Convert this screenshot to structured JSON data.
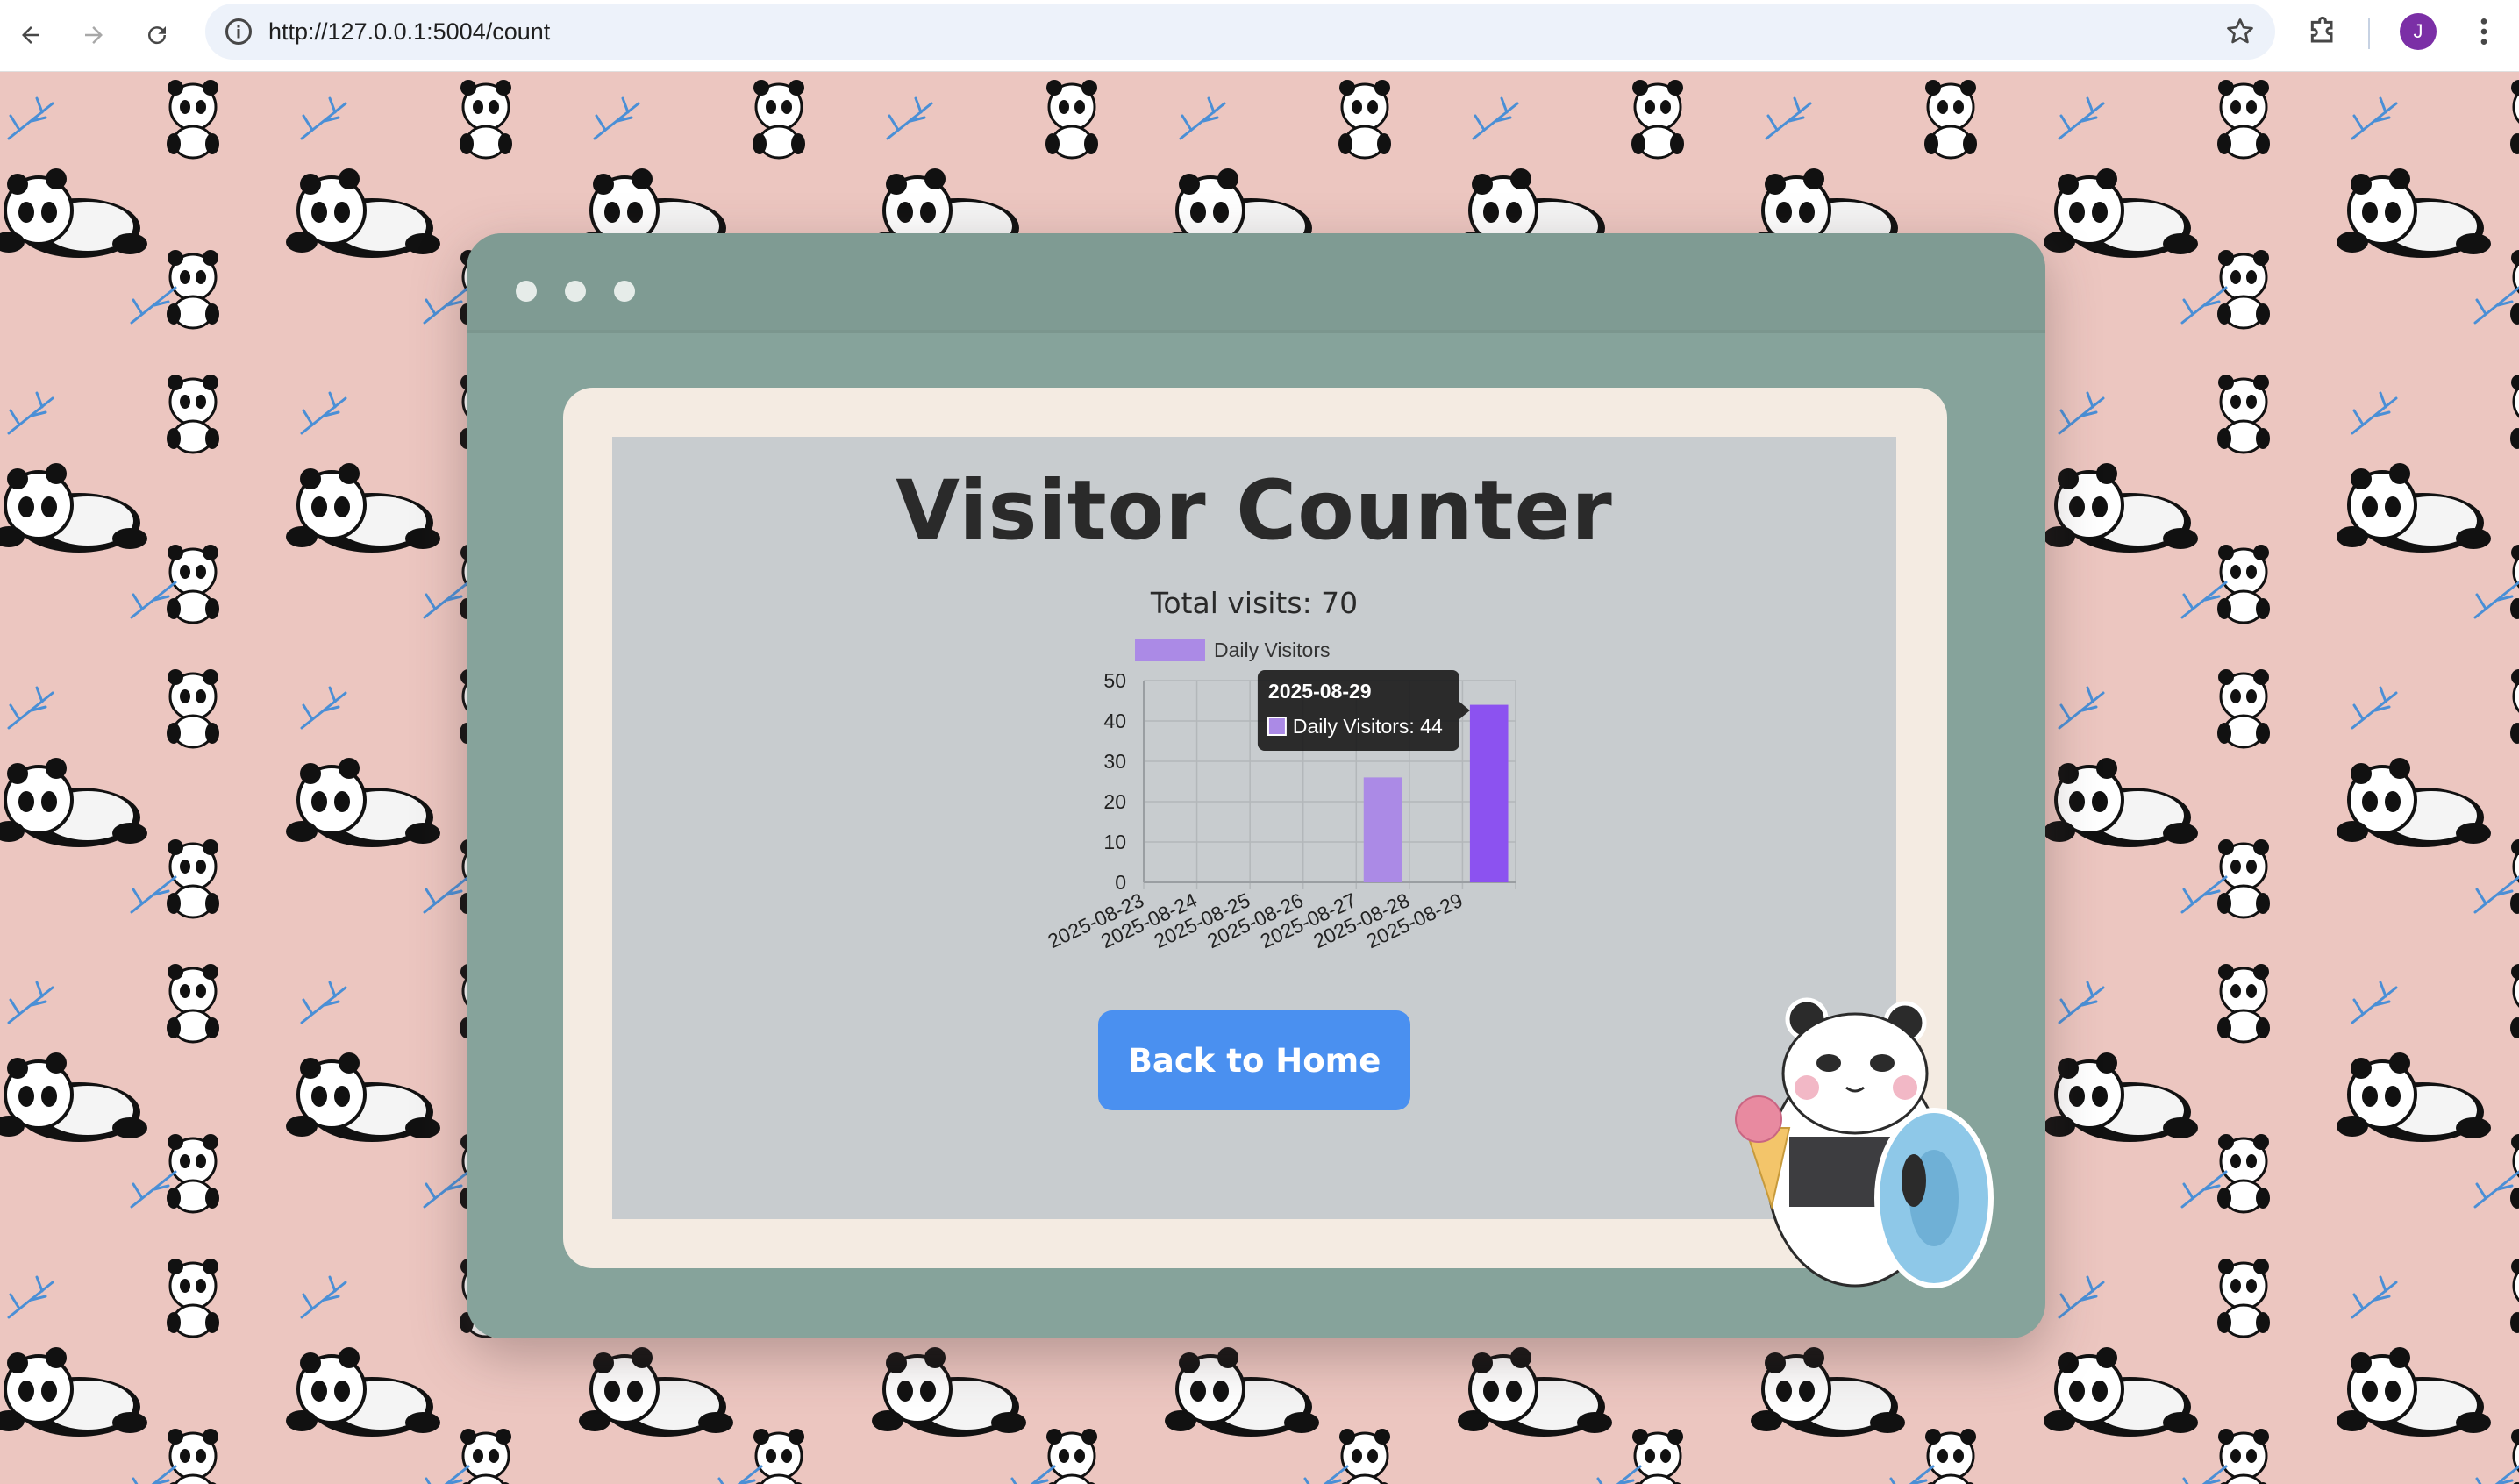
{
  "browser": {
    "url": "http://127.0.0.1:5004/count",
    "profile_initial": "J",
    "icons": [
      "back-icon",
      "forward-icon",
      "reload-icon",
      "site-info-icon",
      "star-icon",
      "extensions-icon",
      "more-menu-icon"
    ]
  },
  "page": {
    "title": "Visitor Counter",
    "total_visits_text": "Total visits: 70",
    "back_button_label": "Back to Home"
  },
  "colors": {
    "background": "#ecc6c0",
    "window": "#86a39b",
    "frame": "#f4ebe2",
    "screen": "#c8cccf",
    "button": "#4a90f0",
    "bar": "#ab8ae6",
    "bar_active": "#8c52f0"
  },
  "chart_data": {
    "type": "bar",
    "categories": [
      "2025-08-23",
      "2025-08-24",
      "2025-08-25",
      "2025-08-26",
      "2025-08-27",
      "2025-08-28",
      "2025-08-29"
    ],
    "series": [
      {
        "name": "Daily Visitors",
        "values": [
          0,
          0,
          0,
          0,
          26,
          0,
          44
        ]
      }
    ],
    "ylim": [
      0,
      50
    ],
    "yticks": [
      0,
      10,
      20,
      30,
      40,
      50
    ],
    "grid": true,
    "legend": "top",
    "tooltip": {
      "title": "2025-08-29",
      "label": "Daily Visitors: 44"
    },
    "active_index": 6
  }
}
